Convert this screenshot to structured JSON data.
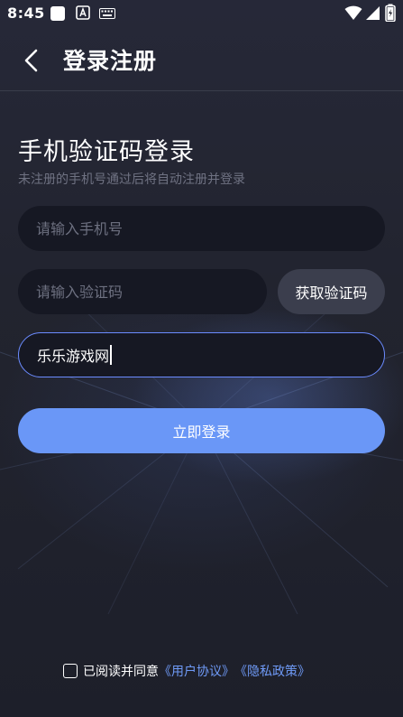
{
  "status_bar": {
    "time": "8:45",
    "icons": [
      "notification-square-icon",
      "app-a-icon",
      "keyboard-icon",
      "wifi-icon",
      "signal-icon",
      "battery-charging-icon"
    ]
  },
  "nav": {
    "back_icon": "chevron-left-icon",
    "title": "登录注册"
  },
  "form": {
    "heading": "手机验证码登录",
    "subheading": "未注册的手机号通过后将自动注册并登录",
    "phone_placeholder": "请输入手机号",
    "code_placeholder": "请输入验证码",
    "get_code_label": "获取验证码",
    "captcha_value": "乐乐游戏网",
    "login_label": "立即登录"
  },
  "agreement": {
    "checked": false,
    "text": "已阅读并同意",
    "user_agreement": "《用户协议》",
    "privacy_policy": "《隐私政策》"
  },
  "colors": {
    "accent": "#6a97f7",
    "link": "#6f9af6",
    "background": "#22242f",
    "input_bg": "#161823",
    "secondary_button": "#3b3e4d"
  }
}
